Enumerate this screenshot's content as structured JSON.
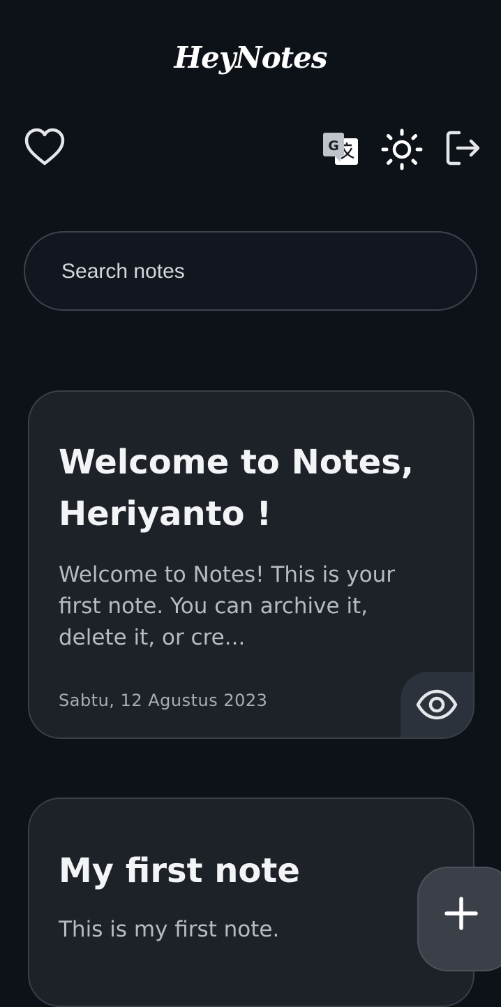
{
  "header": {
    "app_title": "HeyNotes",
    "icons": [
      "heart-outline-icon",
      "translate-icon",
      "sun-icon",
      "logout-icon"
    ]
  },
  "search": {
    "placeholder": "Search notes",
    "value": ""
  },
  "notes": [
    {
      "title": "Welcome to Notes, Heriyanto !",
      "body": "Welcome to Notes! This is your first note. You can archive it, delete it, or cre...",
      "date": "Sabtu, 12 Agustus 2023",
      "action_icon": "eye-icon"
    },
    {
      "title": "My first note",
      "body": "This is my first note."
    }
  ],
  "fab": {
    "icon": "plus-icon"
  },
  "colors": {
    "background": "#0d1118",
    "card": "#1d2128",
    "card_border": "#3a3f48",
    "text_primary": "#f3f4f6",
    "text_secondary": "#b7bbc2"
  }
}
